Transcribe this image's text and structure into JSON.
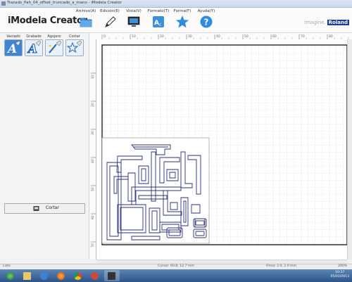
{
  "window": {
    "title": "Trazado_Pah_04_offset_truncado_a_mano - iModela Creator"
  },
  "app": {
    "name": "iModela Creator"
  },
  "toolbar": {
    "items": [
      {
        "label": "Archivo(A)",
        "icon": "folder-icon"
      },
      {
        "label": "Edición(E)",
        "icon": "pencil-icon"
      },
      {
        "label": "Vista(V)",
        "icon": "monitor-icon"
      },
      {
        "label": "Formato(T)",
        "icon": "format-icon"
      },
      {
        "label": "Forma(F)",
        "icon": "star-icon"
      },
      {
        "label": "Ayuda(Y)",
        "icon": "help-icon"
      }
    ]
  },
  "brand": {
    "tagline": "Imagine.",
    "logo": "Roland"
  },
  "left_panel": {
    "tools": [
      {
        "label": "Vaciado",
        "icon": "engrave-icon"
      },
      {
        "label": "Grabado",
        "icon": "grabado-icon"
      },
      {
        "label": "Agujero",
        "icon": "drill-icon"
      },
      {
        "label": "Cortar",
        "icon": "cut-icon"
      }
    ],
    "cut_button": {
      "label": "Cortar"
    }
  },
  "ruler": {
    "top_labels": [
      "0",
      "10",
      "20",
      "30",
      "40",
      "50",
      "60",
      "70",
      "80"
    ],
    "left_labels": [
      "10",
      "20",
      "30",
      "40",
      "50",
      "60",
      "70"
    ]
  },
  "status": {
    "ready": "Listo",
    "cursor": "Cursor: 60.8, 12.7 mm",
    "tool": "Fresa: 2.0, 2.0 mm",
    "zoom": "200%"
  },
  "taskbar": {
    "clock_time": "10:37",
    "clock_date": "05/02/2013"
  },
  "colors": {
    "accent_blue": "#2a75c9",
    "pcb_trace": "#2f2f7e",
    "grid": "#d8d8d8",
    "roland_red": "#1a3d8f"
  }
}
